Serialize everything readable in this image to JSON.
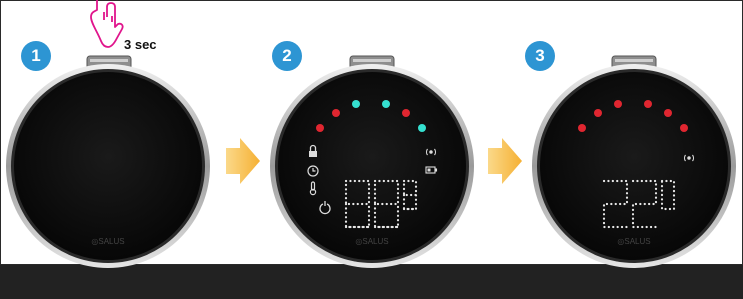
{
  "steps": [
    {
      "number": "1"
    },
    {
      "number": "2"
    },
    {
      "number": "3"
    }
  ],
  "hold_hint": "3 sec",
  "brand_logo": "SALUS",
  "colors": {
    "step_badge": "#2d95d3",
    "arrow": "#f5b940",
    "led_red": "#e02630",
    "led_cyan": "#35e0d0",
    "hand_outline": "#e0158c",
    "footer": "#222222"
  },
  "icons": [
    "hand-press-icon",
    "lock-icon",
    "clock-icon",
    "thermometer-icon",
    "power-icon",
    "wireless-icon",
    "battery-icon"
  ]
}
